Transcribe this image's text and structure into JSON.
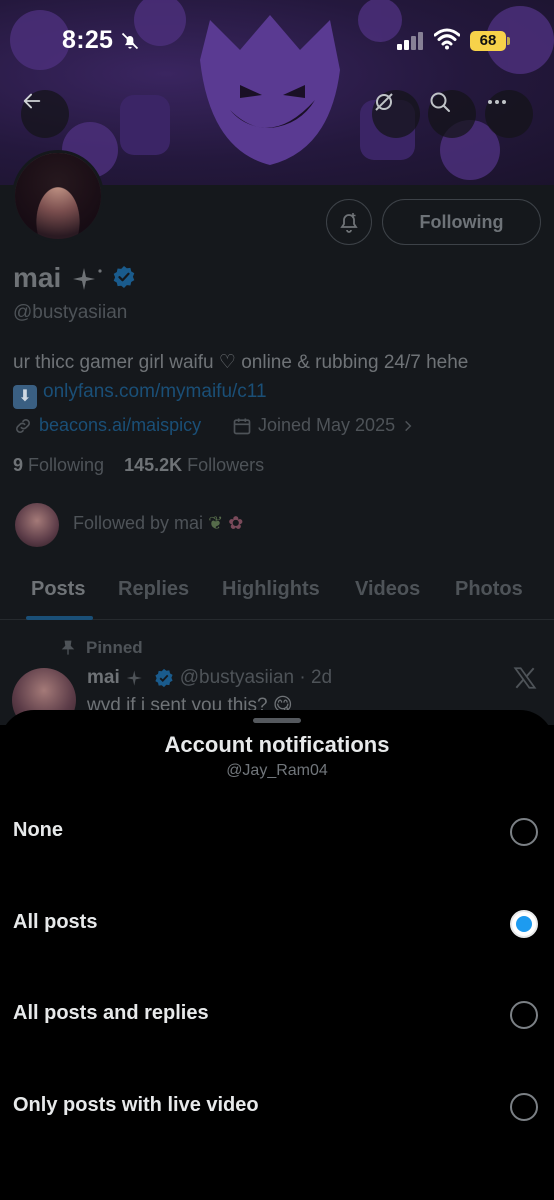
{
  "status_bar": {
    "time": "8:25",
    "battery": "68"
  },
  "profile": {
    "name": "mai",
    "handle": "@bustyasiian",
    "following_button": "Following",
    "bio_text": "ur thicc gamer girl waifu ♡ online & rubbing 24/7 hehe",
    "bio_link": "onlyfans.com/mymaifu/c11",
    "website": "beacons.ai/maispicy",
    "joined": "Joined May 2025",
    "following_count": "9",
    "following_label": "Following",
    "followers_count": "145.2K",
    "followers_label": "Followers",
    "followed_by": "Followed by mai"
  },
  "tabs": [
    {
      "label": "Posts"
    },
    {
      "label": "Replies"
    },
    {
      "label": "Highlights"
    },
    {
      "label": "Videos"
    },
    {
      "label": "Photos"
    }
  ],
  "pinned_post": {
    "pinned_label": "Pinned",
    "author": "mai",
    "handle_time": "@bustyasiian · 2d",
    "text": "wyd if i sent you this? 😋"
  },
  "sheet": {
    "title": "Account notifications",
    "subtitle": "@Jay_Ram04",
    "options": [
      {
        "label": "None",
        "selected": false
      },
      {
        "label": "All posts",
        "selected": true
      },
      {
        "label": "All posts and replies",
        "selected": false
      },
      {
        "label": "Only posts with live video",
        "selected": false
      }
    ]
  },
  "colors": {
    "accent": "#1d9bf0",
    "sheet_background": "#000000"
  }
}
